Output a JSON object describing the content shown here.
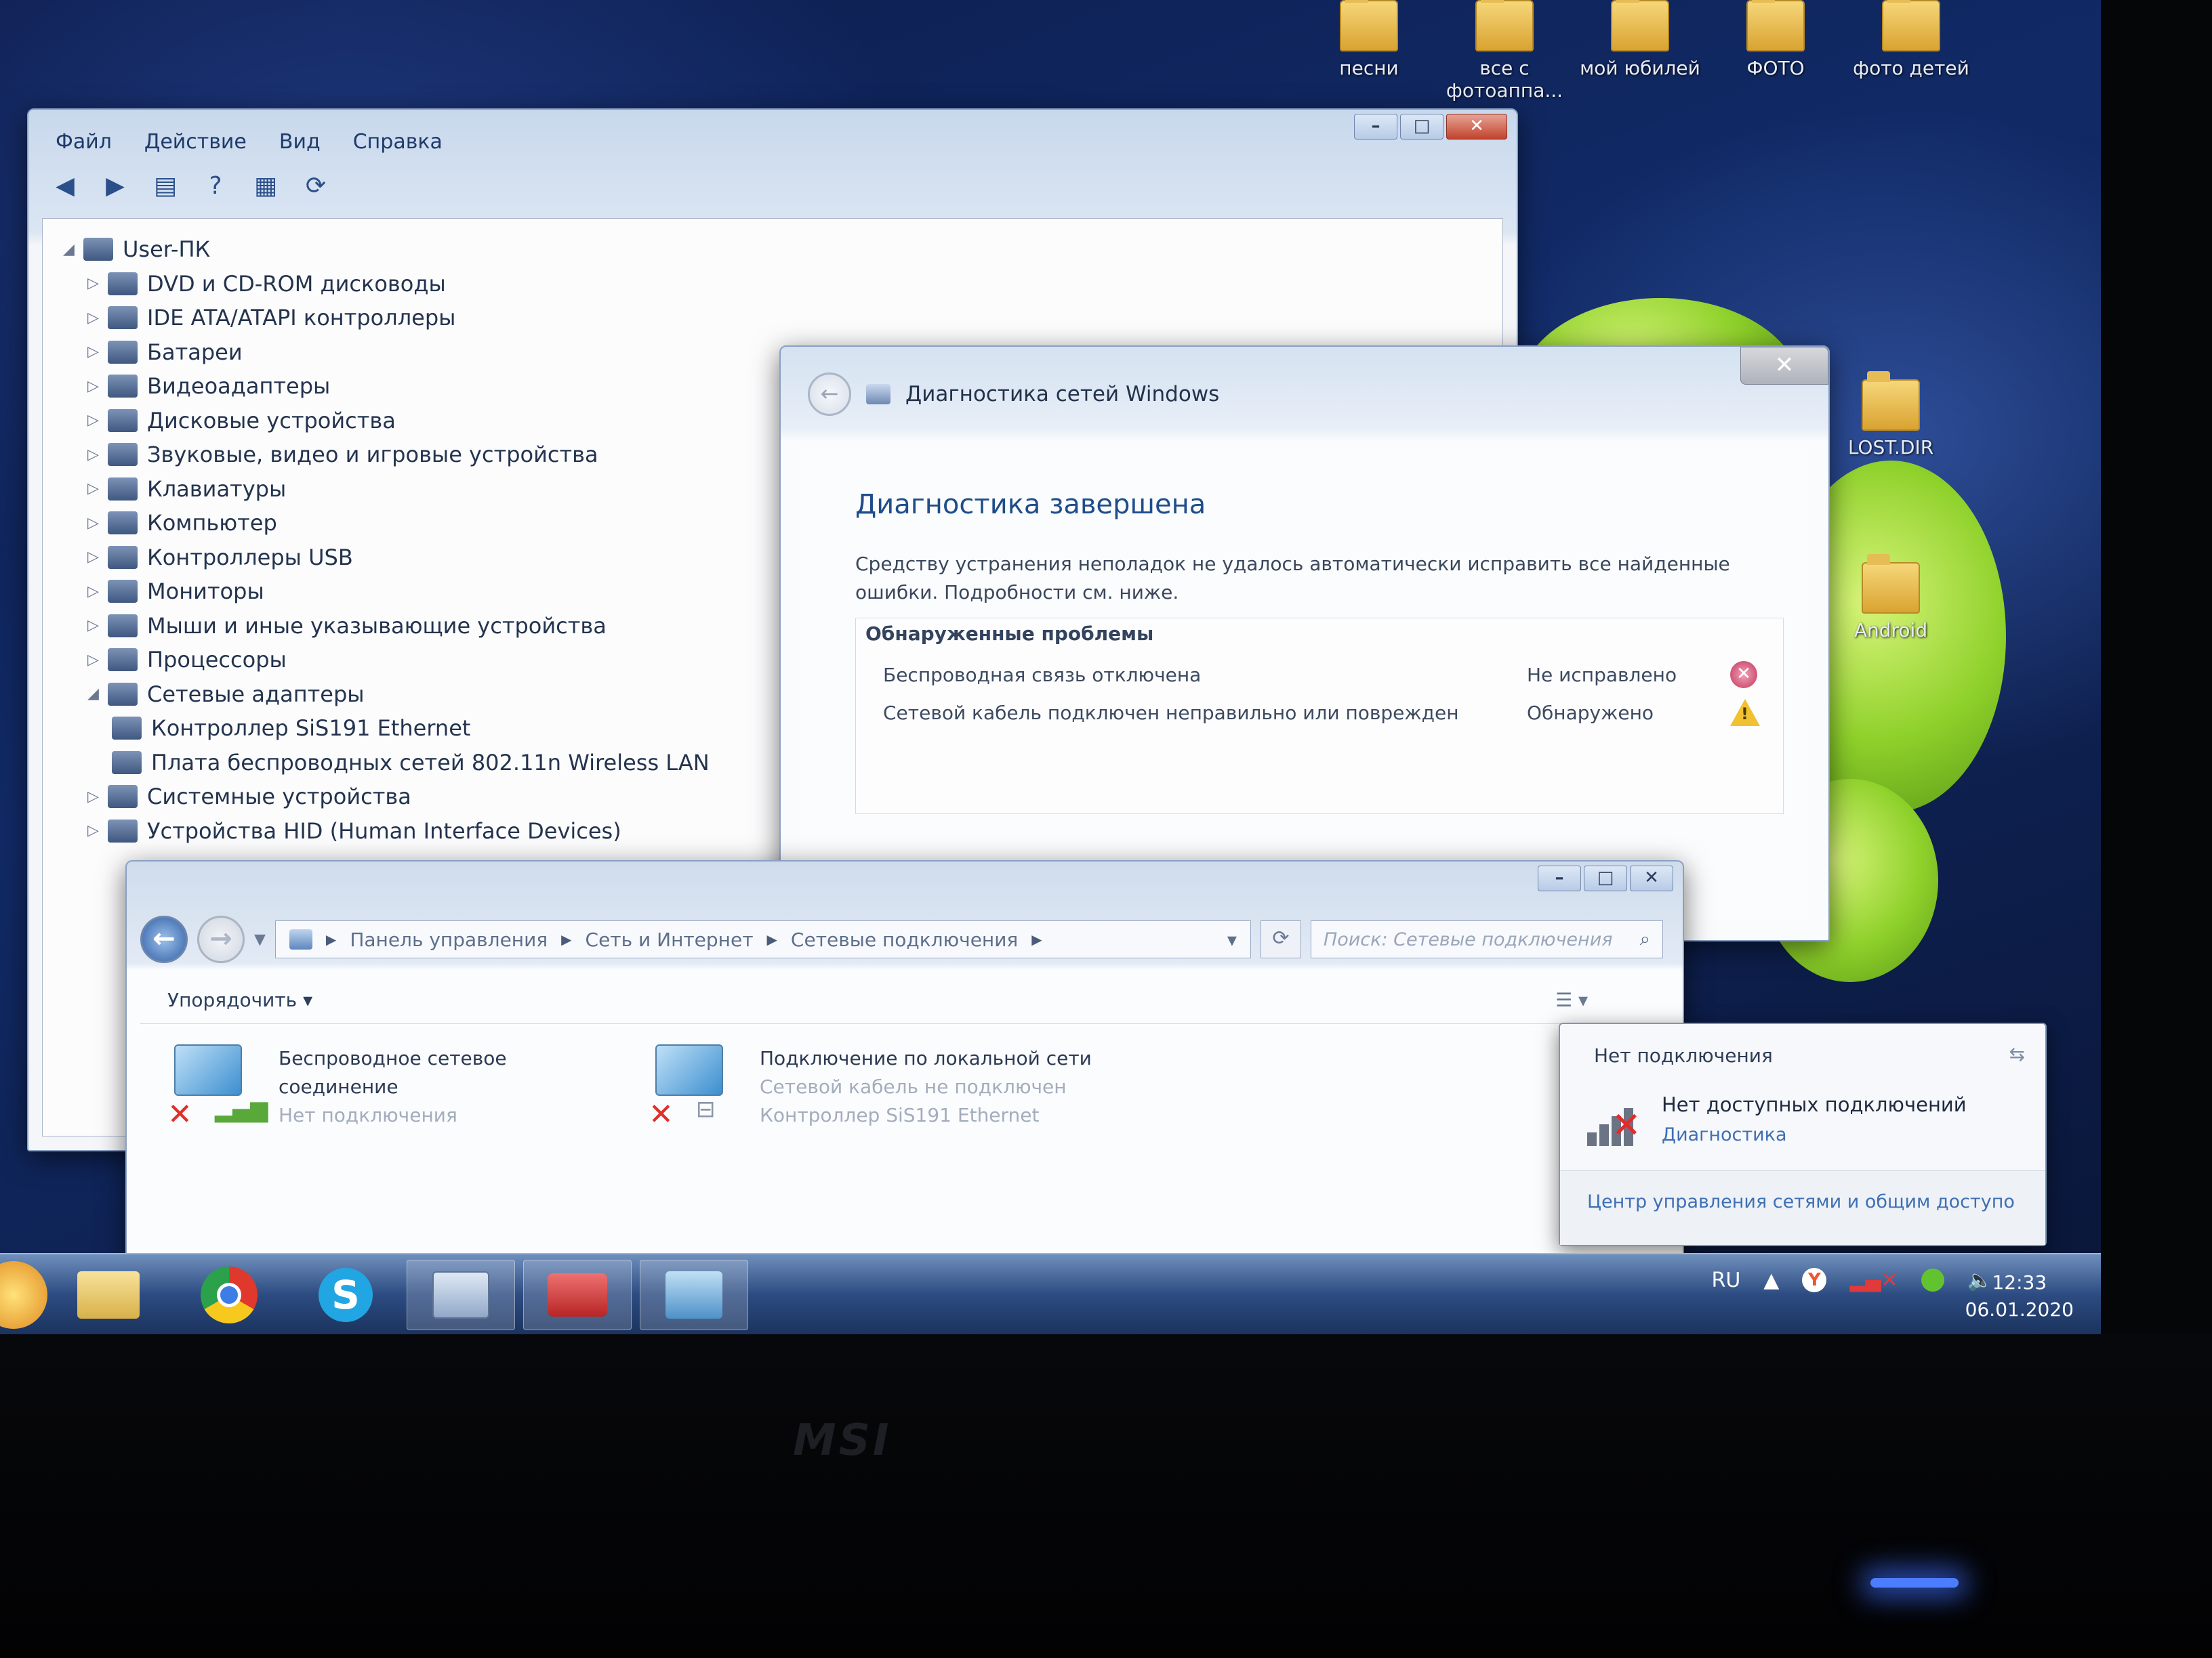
{
  "desktop": {
    "icons": [
      {
        "label": "песни"
      },
      {
        "label": "все с фотоаппа..."
      },
      {
        "label": "мой юбилей"
      },
      {
        "label": "ФОТО"
      },
      {
        "label": "фото детей"
      },
      {
        "label": "LOST.DIR"
      },
      {
        "label": "Android"
      }
    ]
  },
  "device_manager": {
    "menu": [
      "Файл",
      "Действие",
      "Вид",
      "Справка"
    ],
    "tree": [
      {
        "label": "User-ПК",
        "level": "root",
        "expanded": true
      },
      {
        "label": "DVD и CD-ROM дисководы",
        "level": "category"
      },
      {
        "label": "IDE ATA/ATAPI контроллеры",
        "level": "category"
      },
      {
        "label": "Батареи",
        "level": "category"
      },
      {
        "label": "Видеоадаптеры",
        "level": "category"
      },
      {
        "label": "Дисковые устройства",
        "level": "category"
      },
      {
        "label": "Звуковые, видео и игровые устройства",
        "level": "category"
      },
      {
        "label": "Клавиатуры",
        "level": "category"
      },
      {
        "label": "Компьютер",
        "level": "category"
      },
      {
        "label": "Контроллеры USB",
        "level": "category"
      },
      {
        "label": "Мониторы",
        "level": "category"
      },
      {
        "label": "Мыши и иные указывающие устройства",
        "level": "category"
      },
      {
        "label": "Процессоры",
        "level": "category"
      },
      {
        "label": "Сетевые адаптеры",
        "level": "category",
        "expanded": true
      },
      {
        "label": "Контроллер SiS191 Ethernet",
        "level": "device"
      },
      {
        "label": "Плата беспроводных сетей 802.11n Wireless LAN",
        "level": "device"
      },
      {
        "label": "Системные устройства",
        "level": "category"
      },
      {
        "label": "Устройства HID (Human Interface Devices)",
        "level": "category"
      }
    ]
  },
  "diagnostics": {
    "title": "Диагностика сетей Windows",
    "heading": "Диагностика завершена",
    "description": "Средству устранения неполадок не удалось автоматически исправить все найденные ошибки. Подробности см. ниже.",
    "problems_title": "Обнаруженные проблемы",
    "problems": [
      {
        "text": "Беспроводная связь отключена",
        "status": "Не исправлено",
        "icon": "error-icon"
      },
      {
        "text": "Сетевой кабель подключен неправильно или поврежден",
        "status": "Обнаружено",
        "icon": "warning-icon"
      }
    ]
  },
  "network_connections": {
    "breadcrumbs": [
      "Панель управления",
      "Сеть и Интернет",
      "Сетевые подключения"
    ],
    "search_placeholder": "Поиск: Сетевые подключения",
    "organize_label": "Упорядочить",
    "connections": [
      {
        "name_line1": "Беспроводное сетевое",
        "name_line2": "соединение",
        "status": "Нет подключения",
        "device": ""
      },
      {
        "name_line1": "Подключение по локальной сети",
        "name_line2": "",
        "status": "Сетевой кабель не подключен",
        "device": "Контроллер SiS191 Ethernet"
      }
    ]
  },
  "tray_popup": {
    "header": "Нет подключения",
    "main_text": "Нет доступных подключений",
    "link": "Диагностика",
    "footer_link": "Центр управления сетями и общим доступо"
  },
  "taskbar": {
    "language": "RU",
    "time": "12:33",
    "date": "06.01.2020"
  },
  "brand": "MSI"
}
